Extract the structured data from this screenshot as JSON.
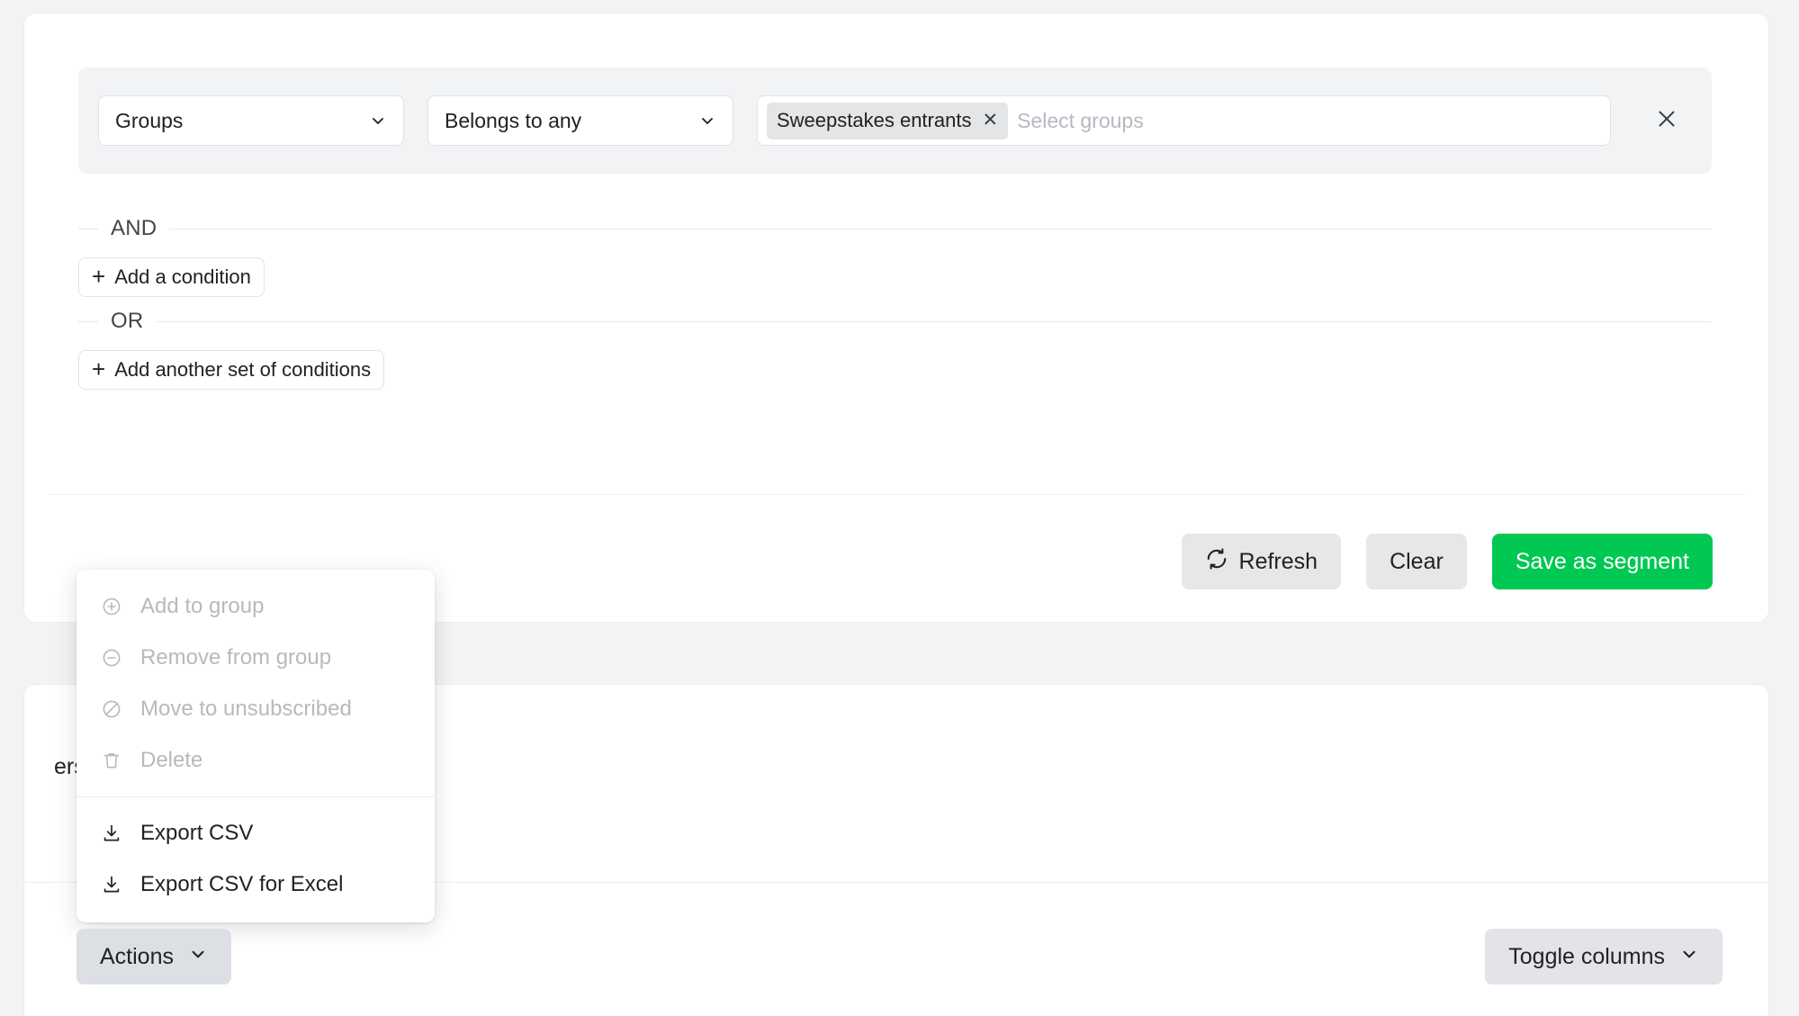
{
  "filter_card": {
    "condition": {
      "field_select": {
        "value": "Groups",
        "icon": "chevron-down-icon"
      },
      "operator_select": {
        "value": "Belongs to any",
        "icon": "chevron-down-icon"
      },
      "groups_input": {
        "chips": [
          {
            "label": "Sweepstakes entrants",
            "remove_icon": "close-icon"
          }
        ],
        "placeholder": "Select groups"
      },
      "remove_icon": "close-icon"
    },
    "and_label": "AND",
    "add_condition_label": "Add a condition",
    "or_label": "OR",
    "add_another_set_label": "Add another set of conditions",
    "buttons": {
      "refresh": {
        "label": "Refresh",
        "icon": "refresh-icon"
      },
      "clear": {
        "label": "Clear"
      },
      "save": {
        "label": "Save as segment"
      }
    }
  },
  "actions_menu": {
    "items": [
      {
        "label": "Add to group",
        "icon": "plus-circle-icon",
        "disabled": true
      },
      {
        "label": "Remove from group",
        "icon": "minus-circle-icon",
        "disabled": true
      },
      {
        "label": "Move to unsubscribed",
        "icon": "ban-icon",
        "disabled": true
      },
      {
        "label": "Delete",
        "icon": "trash-icon",
        "disabled": true
      },
      {
        "label": "Export CSV",
        "icon": "download-icon",
        "disabled": false
      },
      {
        "label": "Export CSV for Excel",
        "icon": "download-icon",
        "disabled": false
      }
    ]
  },
  "table_card": {
    "heading_partial": "ers",
    "actions_button": {
      "label": "Actions",
      "icon": "chevron-down-icon"
    },
    "toggle_columns_button": {
      "label": "Toggle columns",
      "icon": "chevron-down-icon"
    }
  },
  "colors": {
    "primary_green": "#00c853",
    "page_bg": "#f1f3f5",
    "card_bg": "#ffffff",
    "muted_text": "#b6babd"
  }
}
